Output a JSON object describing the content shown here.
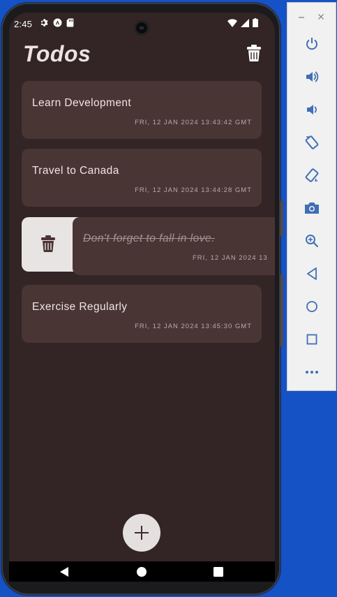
{
  "status_bar": {
    "time": "2:45",
    "left_icons": [
      "gear-icon",
      "a-badge-icon",
      "sd-card-icon"
    ],
    "right_icons": [
      "wifi-icon",
      "signal-icon",
      "battery-icon"
    ]
  },
  "app": {
    "title": "Todos",
    "delete_all_icon": "trash-icon",
    "todos": [
      {
        "title": "Learn Development",
        "date": "FRI, 12 JAN 2024 13:43:42 GMT",
        "done": false
      },
      {
        "title": "Travel to Canada",
        "date": "FRI, 12 JAN 2024 13:44:28 GMT",
        "done": false
      },
      {
        "title": "Don't forget to fall in love.",
        "date": "FRI, 12 JAN 2024 13",
        "done": true,
        "swiped": true
      },
      {
        "title": "Exercise Regularly",
        "date": "FRI, 12 JAN 2024 13:45:30 GMT",
        "done": false
      }
    ],
    "fab_icon": "plus-icon"
  },
  "nav_bar": {
    "buttons": [
      "back-icon",
      "home-icon",
      "recents-icon"
    ]
  },
  "emulator_toolbar": {
    "window_buttons": [
      "minimize-icon",
      "close-icon"
    ],
    "buttons": [
      "power-icon",
      "volume-up-icon",
      "volume-down-icon",
      "rotate-left-icon",
      "rotate-right-icon",
      "camera-icon",
      "zoom-icon",
      "back-icon",
      "home-icon",
      "overview-icon",
      "more-icon"
    ]
  },
  "colors": {
    "background": "#332426",
    "card": "#4a3535",
    "title": "#eee3e3",
    "accent_fab": "#e5e0e0"
  }
}
